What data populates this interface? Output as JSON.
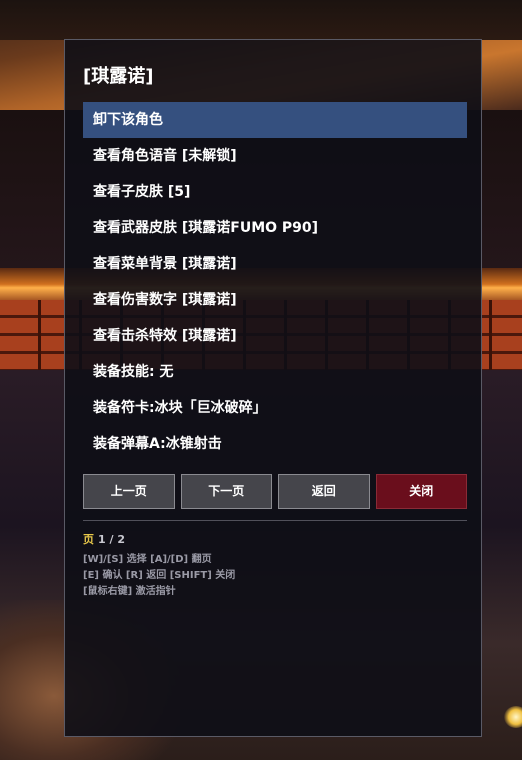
{
  "menu": {
    "title": "[琪露诺]",
    "items": [
      {
        "label": "卸下该角色",
        "selected": true
      },
      {
        "label": "查看角色语音 [未解锁]"
      },
      {
        "label": "查看子皮肤 [5]"
      },
      {
        "label": "查看武器皮肤 [琪露诺FUMO P90]"
      },
      {
        "label": "查看菜单背景 [琪露诺]"
      },
      {
        "label": "查看伤害数字 [琪露诺]"
      },
      {
        "label": "查看击杀特效 [琪露诺]"
      },
      {
        "label": "装备技能: 无"
      },
      {
        "label": "装备符卡:冰块「巨冰破碎」"
      },
      {
        "label": "装备弹幕A:冰锥射击"
      }
    ],
    "buttons": {
      "prev": "上一页",
      "next": "下一页",
      "back": "返回",
      "close": "关闭"
    },
    "page": {
      "label": "页",
      "value": "1 / 2"
    },
    "help": [
      "[W]/[S] 选择  [A]/[D] 翻页",
      "[E] 确认  [R] 返回  [SHIFT] 关闭",
      "[鼠标右键] 激活指针"
    ]
  },
  "colors": {
    "selected_bg": "#35507f",
    "close_bg": "#6a0e1c",
    "page_label": "#e8c84a"
  }
}
